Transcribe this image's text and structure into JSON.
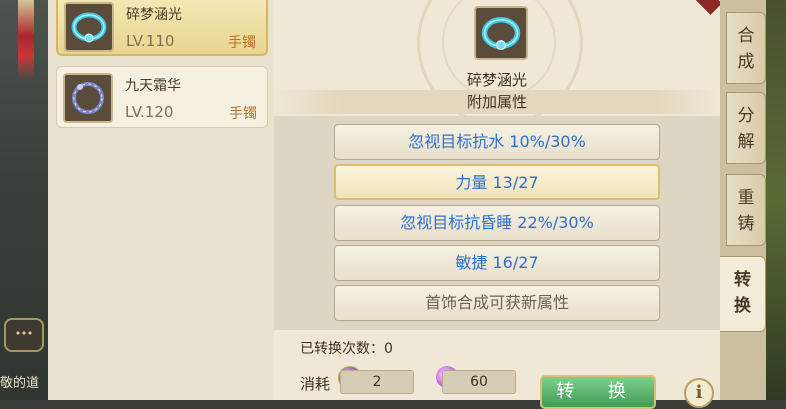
{
  "items": [
    {
      "name": "碎梦涵光",
      "level": "LV.110",
      "type": "手镯",
      "selected": true
    },
    {
      "name": "九天霜华",
      "level": "LV.120",
      "type": "手镯",
      "selected": false
    }
  ],
  "main": {
    "title": "碎梦涵光",
    "section_label": "附加属性",
    "attributes": [
      "忽视目标抗水  10%/30%",
      "力量  13/27",
      "忽视目标抗昏睡  22%/30%",
      "敏捷  16/27",
      "首饰合成可获新属性"
    ],
    "convert_count_label": "已转换次数：0",
    "cost_label": "消耗",
    "cost_item_1": "2",
    "cost_item_2": "60",
    "convert_button": "转  换",
    "info_button": "i"
  },
  "tabs": [
    {
      "label": "合成",
      "active": false
    },
    {
      "label": "分解",
      "active": false
    },
    {
      "label": "重铸",
      "active": false
    },
    {
      "label": "转换",
      "active": true
    }
  ],
  "chat_text": "敬的道",
  "colors": {
    "attr_blue": "#2f6fcf",
    "attr_grey": "#6d6254",
    "level": "#7c6f53",
    "type": "#b5722e"
  },
  "icons": {
    "item_1": "bracelet-blue-icon",
    "item_2": "bracelet-silver-icon",
    "cost_1": "coin-icon",
    "cost_2": "gem-icon",
    "info": "info-icon"
  }
}
